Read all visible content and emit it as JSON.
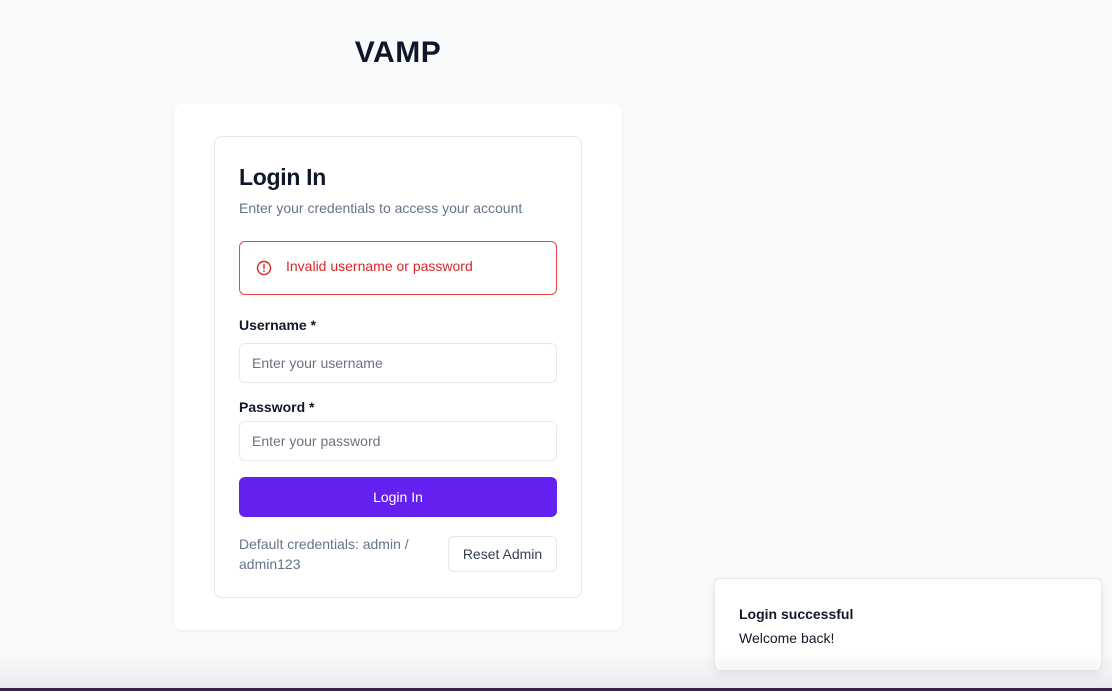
{
  "app": {
    "title": "VAMP"
  },
  "login": {
    "title": "Login In",
    "subtitle": "Enter your credentials to access your account",
    "error": {
      "icon": "alert-circle-icon",
      "message": "Invalid username or password"
    },
    "username": {
      "label": "Username *",
      "value": "",
      "placeholder": "Enter your username"
    },
    "password": {
      "label": "Password *",
      "value": "",
      "placeholder": "Enter your password"
    },
    "submit_label": "Login In",
    "default_credentials": "Default credentials: admin / admin123",
    "reset_label": "Reset Admin"
  },
  "toast": {
    "title": "Login successful",
    "message": "Welcome back!"
  },
  "colors": {
    "accent": "#6320ee",
    "error": "#dc2626",
    "background": "#f9fafb"
  }
}
